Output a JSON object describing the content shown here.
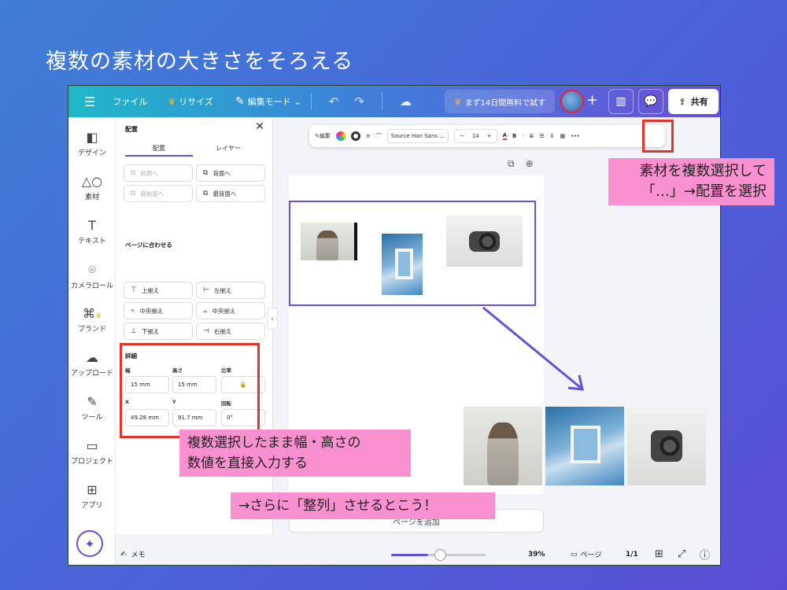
{
  "slide": {
    "title": "複数の素材の大きさをそろえる"
  },
  "topbar": {
    "file": "ファイル",
    "resize": "リサイズ",
    "edit_mode": "編集モード",
    "trial": "まず14日間無料で試す",
    "share": "共有"
  },
  "rail": {
    "items": [
      {
        "label": "デザイン",
        "icon": "design-icon"
      },
      {
        "label": "素材",
        "icon": "elements-icon"
      },
      {
        "label": "テキスト",
        "icon": "text-icon"
      },
      {
        "label": "カメラロール",
        "icon": "camera-icon"
      },
      {
        "label": "ブランド",
        "icon": "brand-icon"
      },
      {
        "label": "アップロード",
        "icon": "upload-icon"
      },
      {
        "label": "ツール",
        "icon": "tools-icon"
      },
      {
        "label": "プロジェクト",
        "icon": "folder-icon"
      },
      {
        "label": "アプリ",
        "icon": "apps-icon"
      }
    ]
  },
  "panel": {
    "title": "配置",
    "tabs": [
      "配置",
      "レイヤー"
    ],
    "layer_buttons": [
      {
        "label": "前面へ",
        "disabled": true
      },
      {
        "label": "背面へ",
        "disabled": false
      },
      {
        "label": "最前面へ",
        "disabled": true
      },
      {
        "label": "最背面へ",
        "disabled": false
      }
    ],
    "fit_page_label": "ページに合わせる",
    "align_buttons": [
      "上揃え",
      "左揃え",
      "中央揃え",
      "中央揃え",
      "下揃え",
      "右揃え"
    ],
    "details": {
      "label": "詳細",
      "width_label": "幅",
      "height_label": "高さ",
      "ratio_label": "比率",
      "width": "15 mm",
      "height": "15 mm",
      "x_label": "X",
      "y_label": "Y",
      "rotate_label": "回転",
      "x": "49.28 mm",
      "y": "91.7 mm",
      "rotate": "0°"
    }
  },
  "text_toolbar": {
    "edit": "編集",
    "font": "Source Han Sans ...",
    "minus": "−",
    "size": "14",
    "plus": "+",
    "more": "···"
  },
  "canvas": {
    "add_page": "ページを追加"
  },
  "bottombar": {
    "memo": "メモ",
    "zoom": "39%",
    "zoom_fraction": 0.39,
    "pages": "ページ",
    "page_count": "1/1"
  },
  "annotations": {
    "top_right": [
      "素材を複数選択して",
      "「…」→配置を選択"
    ],
    "bottom_left": [
      "複数選択したまま幅・高さの",
      "数値を直接入力する"
    ],
    "bottom_center": "→さらに「整列」させるとこう！"
  },
  "colors": {
    "accent": "#6a4fd8",
    "annotation_red": "#e0352b",
    "annotation_pink": "#f990d0"
  }
}
